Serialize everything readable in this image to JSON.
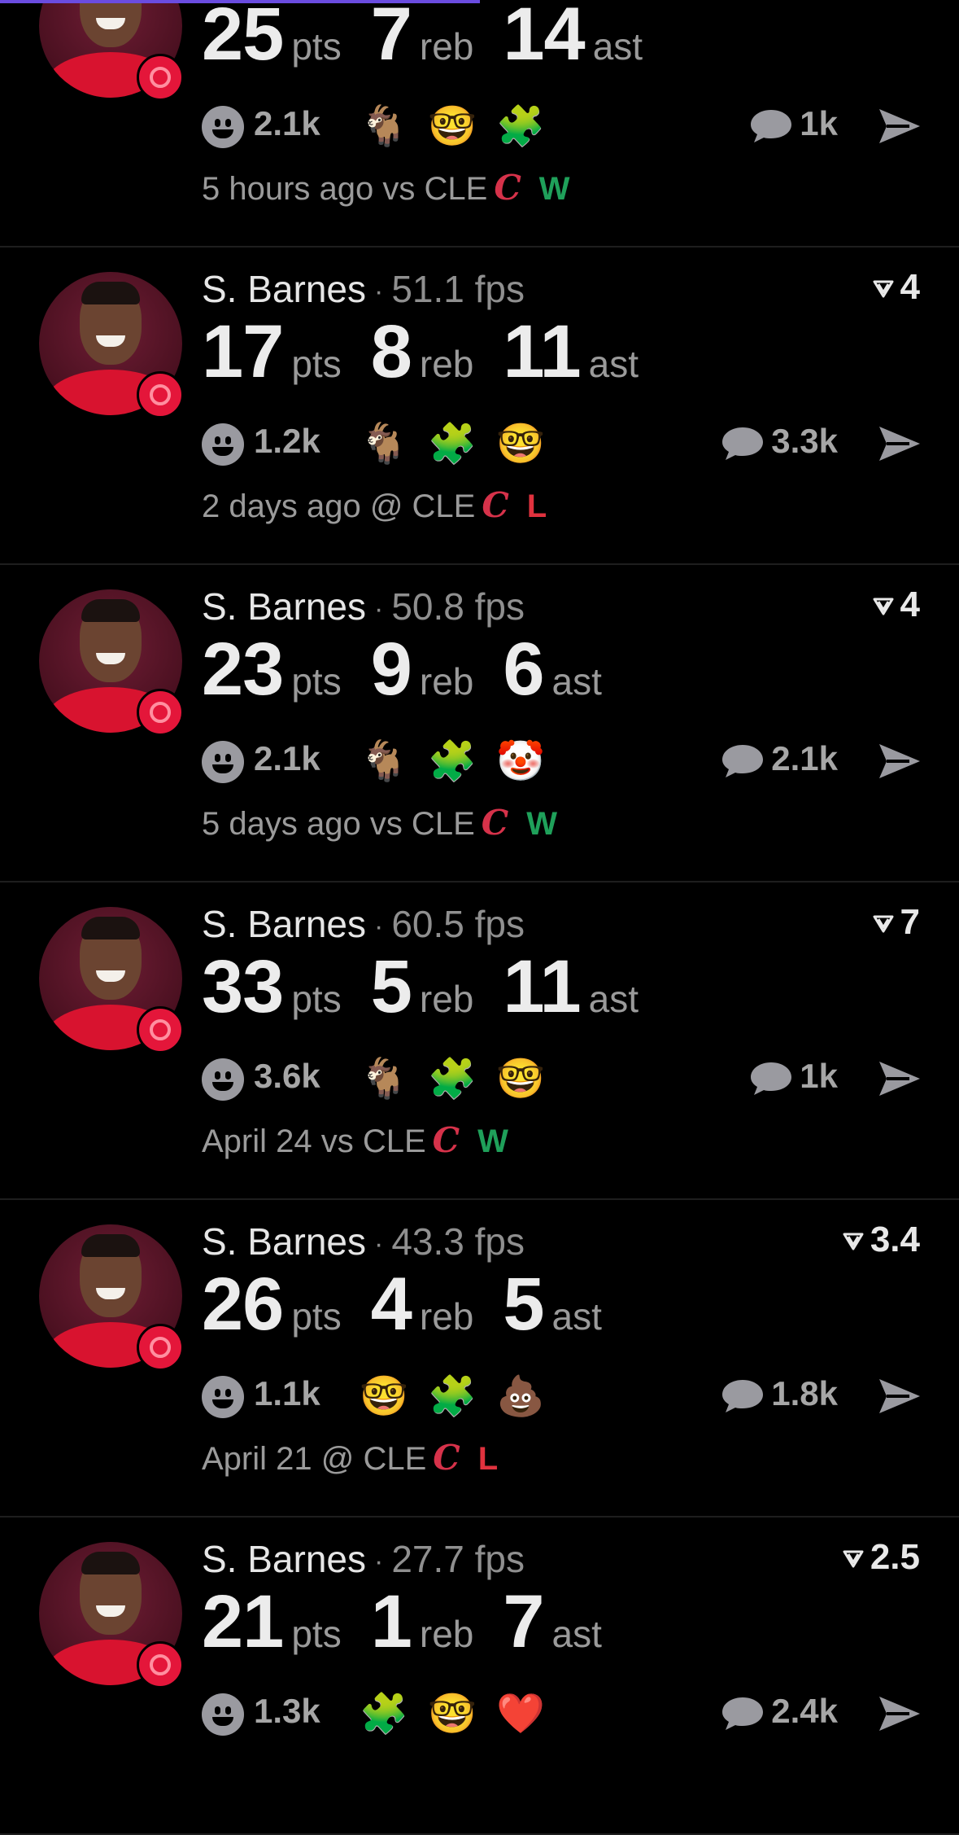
{
  "colors": {
    "background": "#000000",
    "win": "#1fa05a",
    "loss": "#e0323e",
    "accent_progress": "#6a4ce0",
    "muted_text": "#9a9a9a"
  },
  "icons": {
    "reaction": "smiley-icon",
    "comment": "speech-bubble-icon",
    "share": "send-icon",
    "rating": "triangle-flag-icon",
    "team_logo": "raptors-logo",
    "opponent_logo": "cavaliers-logo"
  },
  "posts": [
    {
      "player": "",
      "fps": "",
      "rating": "",
      "stats": [
        {
          "value": "25",
          "unit": "pts"
        },
        {
          "value": "7",
          "unit": "reb"
        },
        {
          "value": "14",
          "unit": "ast"
        }
      ],
      "reactions": "2.1k",
      "emojis": [
        "🐐",
        "🤓",
        "🧩"
      ],
      "comments": "1k",
      "time": "5 hours ago vs CLE",
      "result": "W",
      "result_type": "win"
    },
    {
      "player": "S. Barnes",
      "fps": "51.1 fps",
      "rating": "4",
      "stats": [
        {
          "value": "17",
          "unit": "pts"
        },
        {
          "value": "8",
          "unit": "reb"
        },
        {
          "value": "11",
          "unit": "ast"
        }
      ],
      "reactions": "1.2k",
      "emojis": [
        "🐐",
        "🧩",
        "🤓"
      ],
      "comments": "3.3k",
      "time": "2 days ago @ CLE",
      "result": "L",
      "result_type": "loss"
    },
    {
      "player": "S. Barnes",
      "fps": "50.8 fps",
      "rating": "4",
      "stats": [
        {
          "value": "23",
          "unit": "pts"
        },
        {
          "value": "9",
          "unit": "reb"
        },
        {
          "value": "6",
          "unit": "ast"
        }
      ],
      "reactions": "2.1k",
      "emojis": [
        "🐐",
        "🧩",
        "🤡"
      ],
      "comments": "2.1k",
      "time": "5 days ago vs CLE",
      "result": "W",
      "result_type": "win"
    },
    {
      "player": "S. Barnes",
      "fps": "60.5 fps",
      "rating": "7",
      "stats": [
        {
          "value": "33",
          "unit": "pts"
        },
        {
          "value": "5",
          "unit": "reb"
        },
        {
          "value": "11",
          "unit": "ast"
        }
      ],
      "reactions": "3.6k",
      "emojis": [
        "🐐",
        "🧩",
        "🤓"
      ],
      "comments": "1k",
      "time": "April 24 vs CLE",
      "result": "W",
      "result_type": "win"
    },
    {
      "player": "S. Barnes",
      "fps": "43.3 fps",
      "rating": "3.4",
      "stats": [
        {
          "value": "26",
          "unit": "pts"
        },
        {
          "value": "4",
          "unit": "reb"
        },
        {
          "value": "5",
          "unit": "ast"
        }
      ],
      "reactions": "1.1k",
      "emojis": [
        "🤓",
        "🧩",
        "💩"
      ],
      "comments": "1.8k",
      "time": "April 21 @ CLE",
      "result": "L",
      "result_type": "loss"
    },
    {
      "player": "S. Barnes",
      "fps": "27.7 fps",
      "rating": "2.5",
      "stats": [
        {
          "value": "21",
          "unit": "pts"
        },
        {
          "value": "1",
          "unit": "reb"
        },
        {
          "value": "7",
          "unit": "ast"
        }
      ],
      "reactions": "1.3k",
      "emojis": [
        "🧩",
        "🤓",
        "❤️"
      ],
      "comments": "2.4k",
      "time": "",
      "result": "",
      "result_type": ""
    }
  ]
}
